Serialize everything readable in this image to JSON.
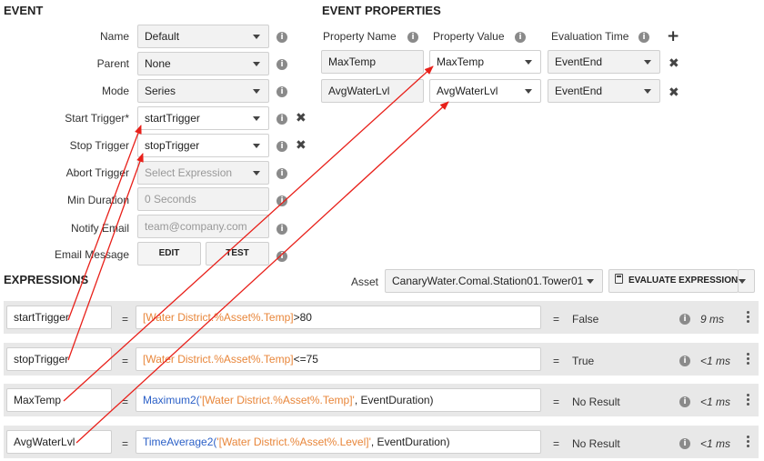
{
  "event": {
    "title": "EVENT",
    "fields": [
      {
        "label": "Name",
        "value": "Default"
      },
      {
        "label": "Parent",
        "value": "None"
      },
      {
        "label": "Mode",
        "value": "Series"
      },
      {
        "label": "Start Trigger*",
        "value": "startTrigger"
      },
      {
        "label": "Stop Trigger",
        "value": "stopTrigger"
      },
      {
        "label": "Abort Trigger",
        "placeholder": "Select Expression"
      },
      {
        "label": "Min Duration",
        "placeholder": "0 Seconds"
      },
      {
        "label": "Notify Email",
        "placeholder": "team@company.com"
      },
      {
        "label": "Email Message"
      }
    ],
    "edit_label": "EDIT",
    "test_label": "TEST"
  },
  "properties": {
    "title": "EVENT PROPERTIES",
    "headers": {
      "name": "Property Name",
      "value": "Property Value",
      "time": "Evaluation Time"
    },
    "rows": [
      {
        "name": "MaxTemp",
        "value": "MaxTemp",
        "time": "EventEnd"
      },
      {
        "name": "AvgWaterLvl",
        "value": "AvgWaterLvl",
        "time": "EventEnd"
      }
    ]
  },
  "expressions": {
    "title": "EXPRESSIONS",
    "asset_label": "Asset",
    "asset_value": "CanaryWater.Comal.Station01.Tower01",
    "evaluate_label": "EVALUATE EXPRESSIONS",
    "equals": "=",
    "rows": [
      {
        "name": "startTrigger",
        "expr_func": "",
        "expr_ref": "[Water District.%Asset%.Temp]",
        "expr_tail": ">80",
        "result": "False",
        "timing": "9 ms"
      },
      {
        "name": "stopTrigger",
        "expr_func": "",
        "expr_ref": "[Water District.%Asset%.Temp]",
        "expr_tail": "<=75",
        "result": "True",
        "timing": "<1 ms"
      },
      {
        "name": "MaxTemp",
        "expr_func": "Maximum2(",
        "expr_ref": "'[Water District.%Asset%.Temp]'",
        "expr_tail": ", EventDuration)",
        "result": "No Result",
        "timing": "<1 ms"
      },
      {
        "name": "AvgWaterLvl",
        "expr_func": "TimeAverage2(",
        "expr_ref": "'[Water District.%Asset%.Level]'",
        "expr_tail": ", EventDuration)",
        "result": "No Result",
        "timing": "<1 ms"
      }
    ]
  },
  "colors": {
    "arrow": "#e8201a",
    "expr_ref": "#e8863a",
    "expr_func": "#2a5fc7"
  },
  "icons": {
    "info": "info-icon",
    "remove": "close-x-icon",
    "add": "plus-icon",
    "calculator": "calculator-icon",
    "menu": "kebab-menu-icon"
  }
}
